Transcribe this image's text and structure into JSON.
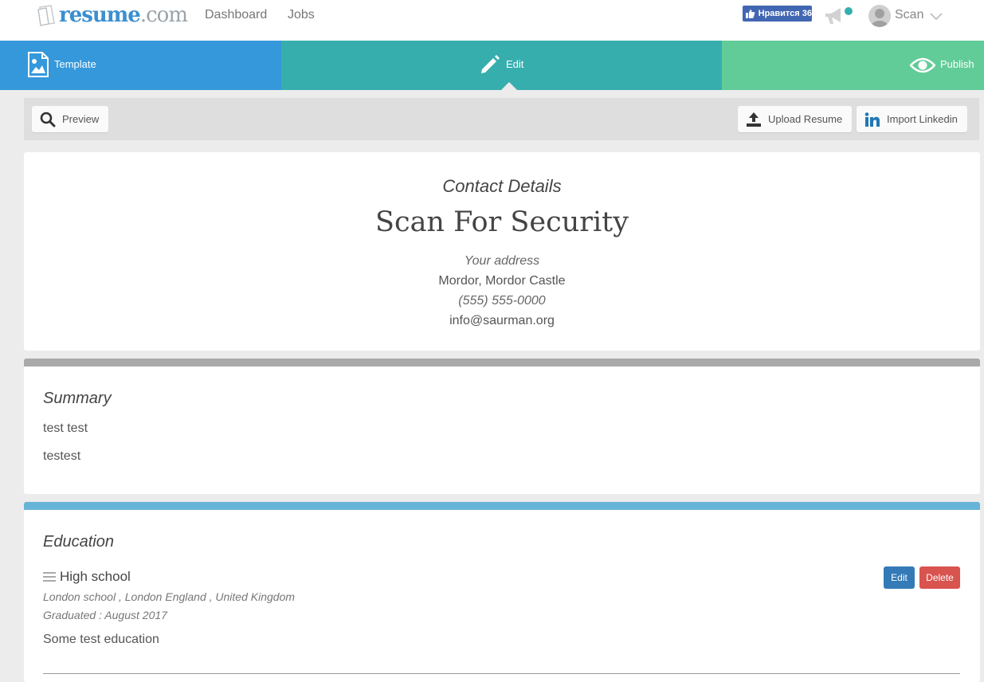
{
  "nav": {
    "logo_brand": "resume",
    "logo_tld": ".com",
    "links": [
      "Dashboard",
      "Jobs"
    ],
    "fb_like": "Нравится 36",
    "user": "Scan"
  },
  "steps": {
    "template": "Template",
    "edit": "Edit",
    "publish": "Publish"
  },
  "toolbar": {
    "preview": "Preview",
    "upload": "Upload Resume",
    "linkedin": "Import Linkedin"
  },
  "contact": {
    "section_title": "Contact Details",
    "name": "Scan For Security",
    "address_label": "Your address",
    "address": "Mordor, Mordor Castle",
    "phone": "(555) 555-0000",
    "email": "info@saurman.org"
  },
  "summary": {
    "title": "Summary",
    "lines": [
      "test test",
      "testest"
    ]
  },
  "education": {
    "title": "Education",
    "item": {
      "heading": "High school",
      "location": "London school , London England , United Kingdom",
      "graduated": "Graduated : August 2017",
      "description": "Some test education",
      "edit_label": "Edit",
      "delete_label": "Delete"
    }
  },
  "colors": {
    "template_step": "#3498db",
    "edit_step": "#37aeae",
    "publish_step": "#62cc99",
    "summary_bar": "#a9a9a9",
    "education_bar": "#68b3d8",
    "edit_button": "#337ab7",
    "delete_button": "#d9534f"
  }
}
